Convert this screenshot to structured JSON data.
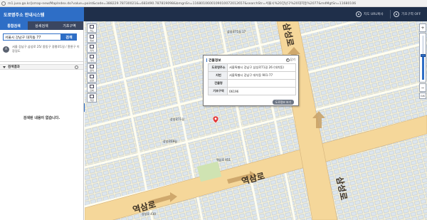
{
  "browser": {
    "url": "m1.juso.go.kr/jsmap-new/MapIndex.do?value=point&code=388229.78730021&=683490.787819098&bmgnSn=1168010600109010072012657&searchStr=서울시%20강남구%20대치동%2077&mdMgtSn=11680106"
  },
  "header": {
    "title": "도로명주소 안내시스템",
    "map_reset_label": "지도 URL복사",
    "basemap_label": "기초구역 OFF"
  },
  "sidebar": {
    "tabs": [
      {
        "label": "통합검색",
        "active": true
      },
      {
        "label": "상세검색",
        "active": false
      },
      {
        "label": "기초구역",
        "active": false
      }
    ],
    "search": {
      "value": "서울시 강남구 대치동 77",
      "button_label": "검색"
    },
    "result": {
      "badge": "A",
      "address": "서울 강남구 삼성로 25/ 중동구 경평로1길 / 흥륜구 이장길도"
    },
    "list_header": "검색결과",
    "empty_message": "검색된 내용이 없습니다."
  },
  "map_toolbar": {
    "items": [
      "지도",
      "위성",
      "지적",
      "거리",
      "면적",
      "반경",
      "인쇄",
      "저장"
    ]
  },
  "zoom": {
    "plus": "+",
    "minus": "−",
    "level_fraction": 0.55,
    "bottom_label": "GIS"
  },
  "popup": {
    "title": "건물정보",
    "close_label": "닫기",
    "rows": [
      {
        "key": "도로명주소",
        "value": "서울특별시 강남구 삼성로71길 26 (대치동)"
      },
      {
        "key": "지번",
        "value": "서울특별시 강남구 대치동 901-77"
      },
      {
        "key": "건물명",
        "value": ""
      },
      {
        "key": "기초구역",
        "value": "06196"
      }
    ],
    "more_label": "도로정보 보기"
  },
  "map_labels": {
    "road_top": "역삼로",
    "road_bottom": "역삼로",
    "road_right_top": "삼성로",
    "road_right_bottom": "삼성로",
    "place_1": "삼성로71길 17",
    "place_2": "삼성로71길",
    "place_3": "삼성로69길",
    "place_4": "역삼로 451",
    "place_5": "삼성로 410"
  }
}
